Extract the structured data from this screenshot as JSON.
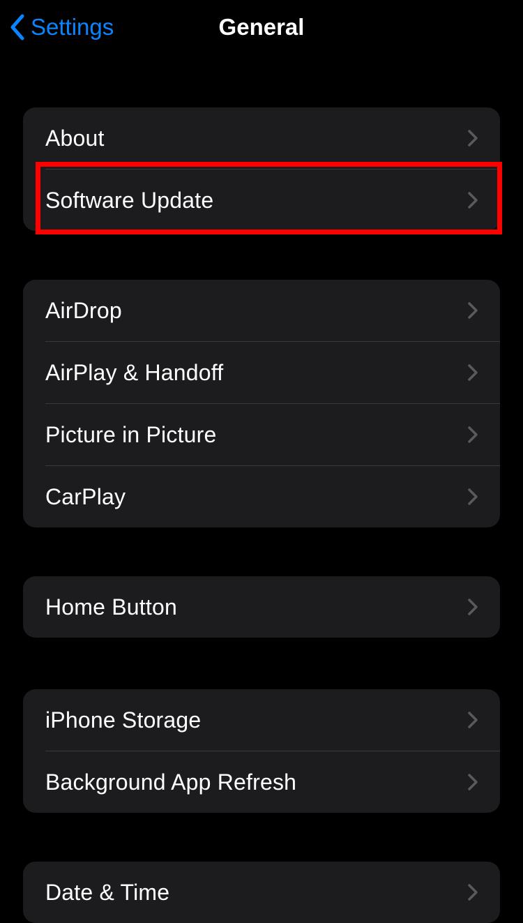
{
  "header": {
    "back_label": "Settings",
    "title": "General"
  },
  "sections": [
    {
      "items": [
        {
          "label": "About"
        },
        {
          "label": "Software Update"
        }
      ]
    },
    {
      "items": [
        {
          "label": "AirDrop"
        },
        {
          "label": "AirPlay & Handoff"
        },
        {
          "label": "Picture in Picture"
        },
        {
          "label": "CarPlay"
        }
      ]
    },
    {
      "items": [
        {
          "label": "Home Button"
        }
      ]
    },
    {
      "items": [
        {
          "label": "iPhone Storage"
        },
        {
          "label": "Background App Refresh"
        }
      ]
    },
    {
      "items": [
        {
          "label": "Date & Time"
        }
      ]
    }
  ]
}
